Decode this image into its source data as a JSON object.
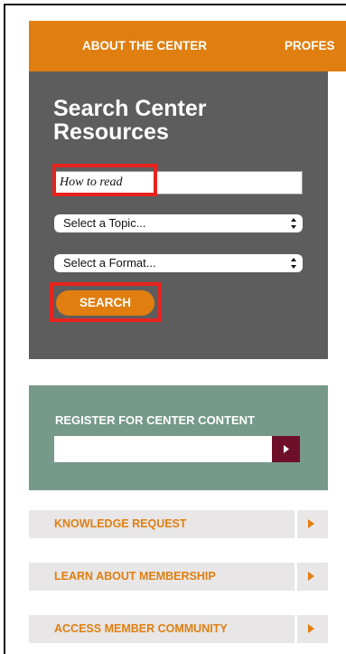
{
  "nav": {
    "items": [
      "ABOUT THE CENTER",
      "PROFES"
    ]
  },
  "search": {
    "title": "Search Center Resources",
    "input_value": "How to read",
    "topic_select": "Select a Topic...",
    "format_select": "Select a Format...",
    "button_label": "SEARCH"
  },
  "register": {
    "title": "REGISTER FOR CENTER CONTENT",
    "input_value": ""
  },
  "links": [
    {
      "label": "KNOWLEDGE REQUEST"
    },
    {
      "label": "LEARN ABOUT MEMBERSHIP"
    },
    {
      "label": "ACCESS MEMBER COMMUNITY"
    }
  ],
  "colors": {
    "accent_orange": "#e07f10",
    "search_panel_gray": "#5e5d5e",
    "register_green": "#76998a",
    "register_button_maroon": "#6e0f2a",
    "highlight_red": "#e8231e",
    "link_row_gray": "#e8e6e6"
  },
  "icons": {
    "select_arrows": "up-down-chevron-icon",
    "register_submit": "play-arrow-icon",
    "link_arrows": "play-arrow-icon"
  }
}
